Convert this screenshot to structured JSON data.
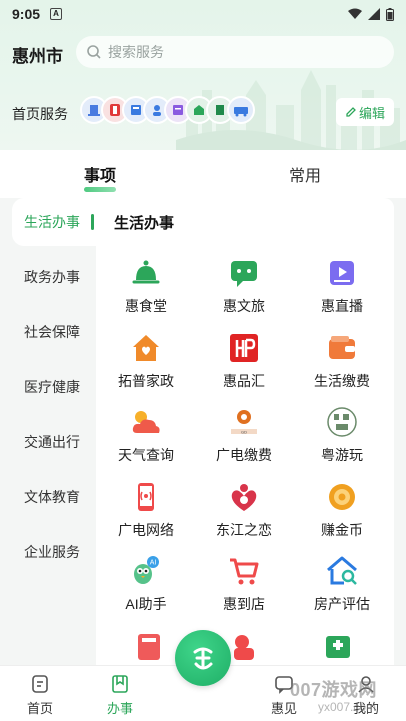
{
  "status_bar": {
    "time": "9:05",
    "notification_badge": "A"
  },
  "header": {
    "city": "惠州市",
    "search_placeholder": "搜索服务",
    "home_services_label": "首页服务",
    "edit_label": "编辑",
    "service_icon_colors": [
      "#e8eef9",
      "#f9e4e4",
      "#e4eefb",
      "#e6eefb",
      "#efe6f7",
      "#e4f2e8",
      "#e3f1ea",
      "#e6eefb"
    ]
  },
  "tabs": {
    "active": "事项",
    "inactive": "常用"
  },
  "sidebar": {
    "items": [
      {
        "label": "生活办事",
        "active": true
      },
      {
        "label": "政务办事",
        "active": false
      },
      {
        "label": "社会保障",
        "active": false
      },
      {
        "label": "医疗健康",
        "active": false
      },
      {
        "label": "交通出行",
        "active": false
      },
      {
        "label": "文体教育",
        "active": false
      },
      {
        "label": "企业服务",
        "active": false
      }
    ]
  },
  "content": {
    "section_title": "生活办事",
    "services": [
      {
        "label": "惠食堂",
        "icon": "dining-bell-icon",
        "color": "#2ca65a"
      },
      {
        "label": "惠文旅",
        "icon": "chat-bubble-icon",
        "color": "#2ca65a"
      },
      {
        "label": "惠直播",
        "icon": "play-screen-icon",
        "color": "#7b6cf0"
      },
      {
        "label": "拓普家政",
        "icon": "house-heart-icon",
        "color": "#f08a2a"
      },
      {
        "label": "惠品汇",
        "icon": "hp-logo-icon",
        "color": "#e02424"
      },
      {
        "label": "生活缴费",
        "icon": "wallet-icon",
        "color": "#f07a3a"
      },
      {
        "label": "天气查询",
        "icon": "weather-icon",
        "color": "#ef5a4a"
      },
      {
        "label": "广电缴费",
        "icon": "broadcast-logo-icon",
        "color": "#e07020"
      },
      {
        "label": "粤游玩",
        "icon": "yue-play-logo-icon",
        "color": "#6a8a6a"
      },
      {
        "label": "广电网络",
        "icon": "phone-signal-icon",
        "color": "#ef4a4a"
      },
      {
        "label": "东江之恋",
        "icon": "heart-figure-icon",
        "color": "#d8344a"
      },
      {
        "label": "赚金币",
        "icon": "coin-icon",
        "color": "#f0a020"
      },
      {
        "label": "AI助手",
        "icon": "ai-bird-icon",
        "color": "#3aa0e8"
      },
      {
        "label": "惠到店",
        "icon": "shopping-cart-icon",
        "color": "#ef4a4a"
      },
      {
        "label": "房产评估",
        "icon": "house-search-icon",
        "color": "#2a7ae0"
      }
    ]
  },
  "bottom_nav": {
    "home": "首页",
    "office": "办事",
    "hui_see": "惠见",
    "mine": "我的"
  },
  "watermark": {
    "main": "007游戏网",
    "sub": "yx007.com"
  },
  "colors": {
    "accent": "#2ca65a"
  }
}
